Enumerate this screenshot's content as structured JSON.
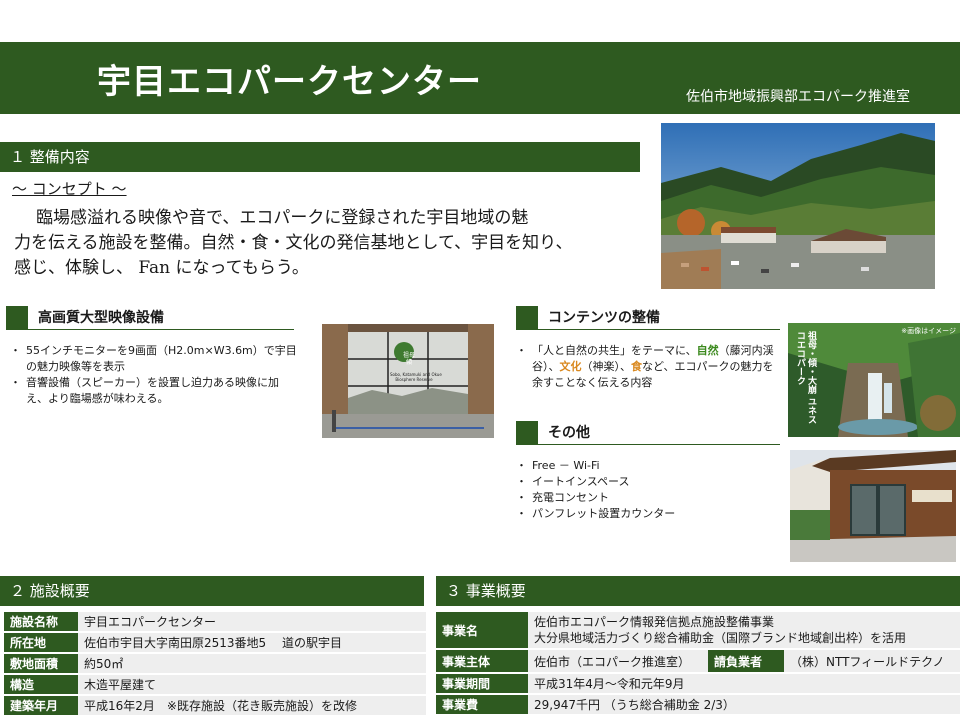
{
  "header": {
    "title": "宇目エコパークセンター",
    "department": "佐伯市地域振興部エコパーク推進室"
  },
  "section1": {
    "heading": "１ 整備内容",
    "concept_label": "～ コンセプト ～",
    "concept_line1": "臨場感溢れる映像や音で、エコパークに登録された宇目地域の魅",
    "concept_line2": "力を伝える施設を整備。自然・食・文化の発信基地として、宇目を知り、",
    "concept_line3": "感じ、体験し、 Fan になってもらう。"
  },
  "video": {
    "heading": "高画質大型映像設備",
    "bullets": [
      "55インチモニターを9画面（H2.0m×W3.6m）で宇目の魅力映像等を表示",
      "音響設備（スピーカー）を設置し迫力ある映像に加え、より臨場感が味わえる。"
    ]
  },
  "contents": {
    "heading": "コンテンツの整備",
    "b1_a": "「人と自然の共生」をテーマに、",
    "b1_nature": "自然",
    "b1_b": "（藤河内渓谷）、",
    "b1_culture": "文化",
    "b1_c": "（神楽）、",
    "b1_food": "食",
    "b1_d": "など、エコパークの魅力を余すことなく伝える内容"
  },
  "other": {
    "heading": "その他",
    "bullets": [
      "Free － Wi-Fi",
      "イートインスペース",
      "充電コンセント",
      "パンフレット設置カウンター"
    ]
  },
  "images": {
    "screen_logo_top": "祖母",
    "screen_logo_bottom": "傾",
    "screen_caption": "Sobo, Katamuki and Okue",
    "screen_caption2": "Biosphere Reserve",
    "waterfall_note": "※画像はイメージ",
    "waterfall_v1": "祖母・傾・大崩",
    "waterfall_v2": "ユネスコエコパーク"
  },
  "section2": {
    "heading": "２ 施設概要",
    "rows": [
      {
        "label": "施設名称",
        "value": "宇目エコパークセンター"
      },
      {
        "label": "所在地",
        "value": "佐伯市宇目大字南田原2513番地5　 道の駅宇目"
      },
      {
        "label": "敷地面積",
        "value": "約50㎡"
      },
      {
        "label": "構造",
        "value": "木造平屋建て"
      },
      {
        "label": "建築年月",
        "value": "平成16年2月　※既存施設（花き販売施設）を改修"
      }
    ]
  },
  "section3": {
    "heading": "３ 事業概要",
    "project_label": "事業名",
    "project_line1": "佐伯市エコパーク情報発信拠点施設整備事業",
    "project_line2": "大分県地域活力づくり総合補助金（国際ブランド地域創出枠）を活用",
    "owner_label": "事業主体",
    "owner_value": "佐伯市（エコパーク推進室）",
    "contractor_label": "請負業者",
    "contractor_value": "（株）NTTフィールドテクノ",
    "period_label": "事業期間",
    "period_value": "平成31年4月～令和元年9月",
    "cost_label": "事業費",
    "cost_value": "29,947千円 （うち総合補助金 2/3）"
  }
}
